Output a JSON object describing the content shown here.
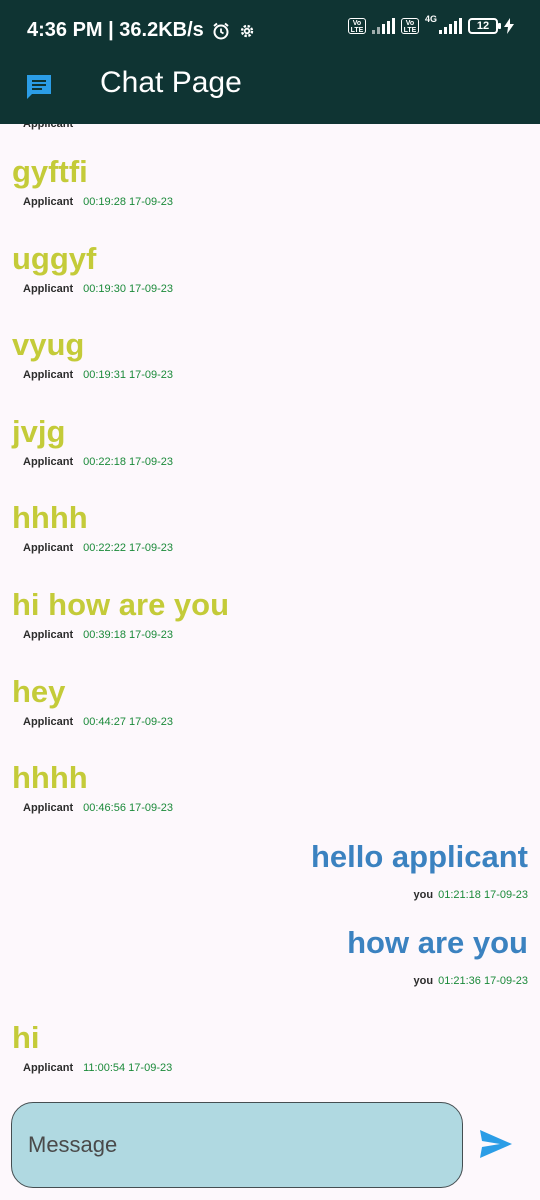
{
  "status_bar": {
    "time_speed": "4:36 PM | 36.2KB/s",
    "network": "4G",
    "sim_badge": "Vo LTE",
    "battery": "12"
  },
  "app_bar": {
    "title": "Chat Page",
    "icon": "chat-message-icon"
  },
  "messages": [
    {
      "text": "gyftfi",
      "sender": "Applicant",
      "time": "00:19:28 17-09-23",
      "side": "left"
    },
    {
      "text": "uggyf",
      "sender": "Applicant",
      "time": "00:19:30 17-09-23",
      "side": "left"
    },
    {
      "text": "vyug",
      "sender": "Applicant",
      "time": "00:19:31 17-09-23",
      "side": "left"
    },
    {
      "text": "jvjg",
      "sender": "Applicant",
      "time": "00:22:18 17-09-23",
      "side": "left"
    },
    {
      "text": "hhhh",
      "sender": "Applicant",
      "time": "00:22:22 17-09-23",
      "side": "left"
    },
    {
      "text": "hi how are you",
      "sender": "Applicant",
      "time": "00:39:18 17-09-23",
      "side": "left"
    },
    {
      "text": "hey",
      "sender": "Applicant",
      "time": "00:44:27 17-09-23",
      "side": "left"
    },
    {
      "text": "hhhh",
      "sender": "Applicant",
      "time": "00:46:56 17-09-23",
      "side": "left"
    },
    {
      "text": "hello applicant",
      "sender": "you",
      "time": "01:21:18 17-09-23",
      "side": "right"
    },
    {
      "text": "how are you",
      "sender": "you",
      "time": "01:21:36 17-09-23",
      "side": "right"
    },
    {
      "text": "hi",
      "sender": "Applicant",
      "time": "11:00:54 17-09-23",
      "side": "left"
    }
  ],
  "composer": {
    "placeholder": "Message",
    "value": "",
    "send_icon": "send-icon"
  },
  "colors": {
    "app_bar": "#0f3433",
    "applicant_text": "#c4cb39",
    "own_text": "#3b82c0",
    "timestamp": "#1b8a3a",
    "input_bg": "#b0d9e1"
  }
}
